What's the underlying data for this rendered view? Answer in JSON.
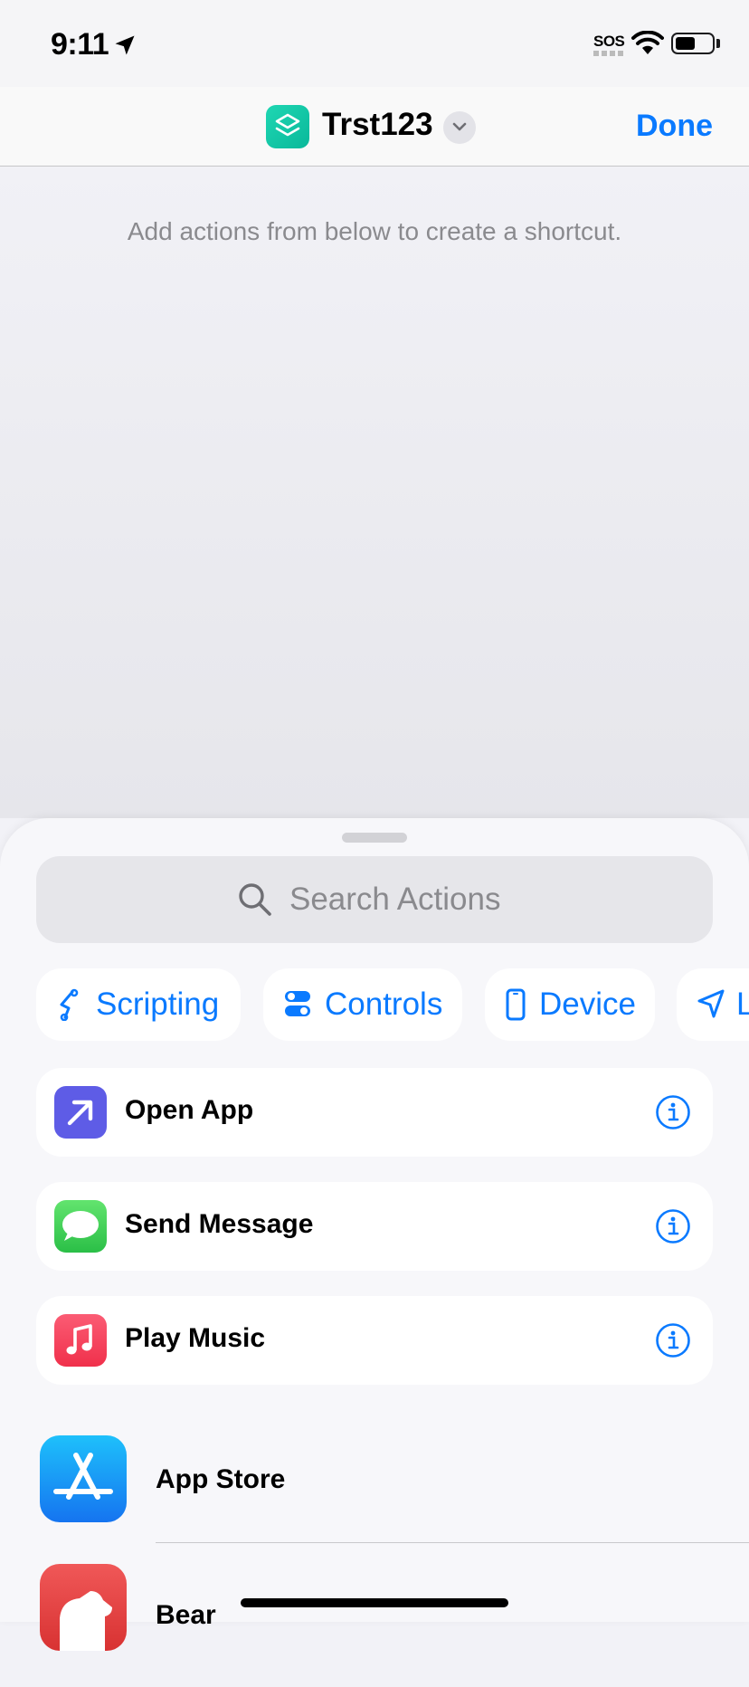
{
  "status_bar": {
    "time": "9:11",
    "sos": "SOS",
    "battery_level": 0.55
  },
  "nav": {
    "title": "Trst123",
    "done_label": "Done",
    "app_icon_color": "#14c7a5"
  },
  "editor": {
    "empty_hint": "Add actions from below to create a shortcut."
  },
  "sheet": {
    "search_placeholder": "Search Actions",
    "categories": [
      {
        "label": "Scripting",
        "icon": "scripting-icon"
      },
      {
        "label": "Controls",
        "icon": "controls-icon"
      },
      {
        "label": "Device",
        "icon": "device-icon"
      },
      {
        "label": "L",
        "icon": "location-icon"
      }
    ],
    "suggestions": [
      {
        "label": "Open App",
        "icon": "open-app-icon",
        "color": "#5e5ce6"
      },
      {
        "label": "Send Message",
        "icon": "messages-icon",
        "color": "#34c759"
      },
      {
        "label": "Play Music",
        "icon": "music-icon",
        "color": "#fa3c55"
      }
    ],
    "apps": [
      {
        "label": "App Store",
        "icon": "app-store-icon",
        "color": "#1a8cff"
      },
      {
        "label": "Bear",
        "icon": "bear-icon",
        "color": "#e03c3c"
      }
    ]
  },
  "accent_color": "#0a7aff"
}
